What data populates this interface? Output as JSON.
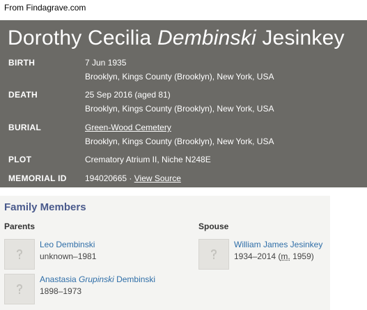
{
  "caption": "From Findagrave.com",
  "memorial": {
    "name_first": "Dorothy Cecilia",
    "name_maiden": "Dembinski",
    "name_last": "Jesinkey",
    "birth": {
      "label": "BIRTH",
      "date": "7 Jun 1935",
      "place": "Brooklyn, Kings County (Brooklyn), New York, USA"
    },
    "death": {
      "label": "DEATH",
      "date": "25 Sep 2016 (aged 81)",
      "place": "Brooklyn, Kings County (Brooklyn), New York, USA"
    },
    "burial": {
      "label": "BURIAL",
      "cemetery": "Green-Wood Cemetery",
      "place": "Brooklyn, Kings County (Brooklyn), New York, USA"
    },
    "plot": {
      "label": "PLOT",
      "value": "Crematory Atrium II, Niche N248E"
    },
    "memorial_id": {
      "label": "MEMORIAL ID",
      "value": "194020665 · ",
      "link": "View Source"
    }
  },
  "family": {
    "heading": "Family Members",
    "parents_label": "Parents",
    "spouse_label": "Spouse",
    "parents": [
      {
        "name": "Leo Dembinski",
        "dates": "unknown–1981"
      },
      {
        "name_first": "Anastasia",
        "name_maiden": "Grupinski",
        "name_last": "Dembinski",
        "dates": "1898–1973"
      }
    ],
    "spouse": {
      "name": "William James Jesinkey",
      "dates": "1934–2014 (",
      "marriage_abbr": "m.",
      "marriage_year": " 1959)"
    }
  },
  "colors": {
    "banner": "#6b6a66",
    "link": "#2f6ea8",
    "heading": "#4a5a8c",
    "panel": "#f4f4f2"
  },
  "icons": {
    "photo_placeholder": "question-mark-icon"
  }
}
